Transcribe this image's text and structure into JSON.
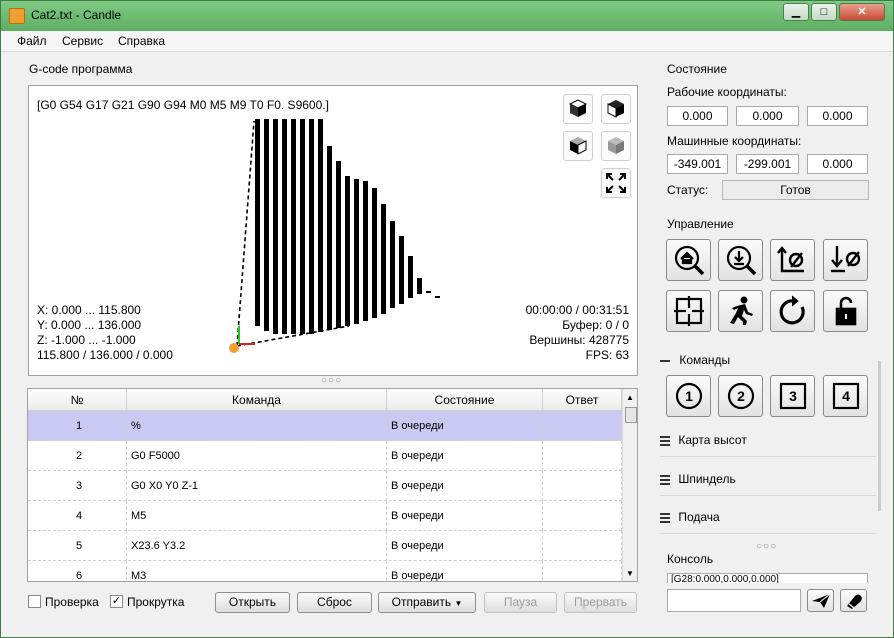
{
  "window": {
    "title": "Cat2.txt - Candle",
    "minimize_glyph": "▁",
    "maximize_glyph": "□",
    "close_glyph": "✕"
  },
  "menu": [
    "Файл",
    "Сервис",
    "Справка"
  ],
  "program": {
    "group_title": "G-code программа",
    "state_line": "[G0 G54 G17 G21 G90 G94 M0 M5 M9 T0 F0. S9600.]",
    "bounds": [
      "X: 0.000 ... 115.800",
      "Y: 0.000 ... 136.000",
      "Z: -1.000 ... -1.000",
      "115.800 / 136.000 / 0.000"
    ],
    "stats": [
      "00:00:00 / 00:31:51",
      "Буфер: 0 / 0",
      "Вершины: 428775",
      "FPS: 63"
    ],
    "view_buttons": [
      "cube-top-icon",
      "cube-front-icon",
      "cube-left-icon",
      "cube-iso-icon",
      "fit-icon"
    ],
    "splitter": "○○○"
  },
  "table": {
    "headers": [
      "№",
      "Команда",
      "Состояние",
      "Ответ"
    ],
    "rows": [
      {
        "n": "1",
        "cmd": "%",
        "state": "В очереди",
        "resp": ""
      },
      {
        "n": "2",
        "cmd": "G0 F5000",
        "state": "В очереди",
        "resp": ""
      },
      {
        "n": "3",
        "cmd": "G0 X0 Y0 Z-1",
        "state": "В очереди",
        "resp": ""
      },
      {
        "n": "4",
        "cmd": "M5",
        "state": "В очереди",
        "resp": ""
      },
      {
        "n": "5",
        "cmd": "X23.6 Y3.2",
        "state": "В очереди",
        "resp": ""
      },
      {
        "n": "6",
        "cmd": "M3",
        "state": "В очереди",
        "resp": ""
      }
    ]
  },
  "bottom": {
    "check_label": "Проверка",
    "scroll_label": "Прокрутка",
    "scroll_checked": true,
    "open": "Открыть",
    "reset": "Сброс",
    "send": "Отправить",
    "pause": "Пауза",
    "abort": "Прервать"
  },
  "state": {
    "title": "Состояние",
    "work_label": "Рабочие координаты:",
    "work": [
      "0.000",
      "0.000",
      "0.000"
    ],
    "machine_label": "Машинные координаты:",
    "machine": [
      "-349.001",
      "-299.001",
      "0.000"
    ],
    "status_label": "Статус:",
    "status": "Готов"
  },
  "control": {
    "title": "Управление",
    "buttons": [
      "home-icon",
      "probe-z-icon",
      "zero-xy-icon",
      "zero-z-icon",
      "restore-origin-icon",
      "safe-position-icon",
      "reset-icon",
      "unlock-icon"
    ]
  },
  "commands": {
    "title": "Команды",
    "buttons": [
      "1",
      "2",
      "3",
      "4"
    ]
  },
  "heightmap": {
    "title": "Карта высот"
  },
  "spindle": {
    "title": "Шпиндель"
  },
  "feed": {
    "title": "Подача"
  },
  "console": {
    "title": "Консоль",
    "log_line": "[G28:0.000,0.000,0.000]",
    "input": "",
    "splitter": "○○○"
  },
  "colors": {
    "title_green": "#5eae63",
    "selection": "#c9c9f2",
    "tool_orange": "#f0a030"
  }
}
